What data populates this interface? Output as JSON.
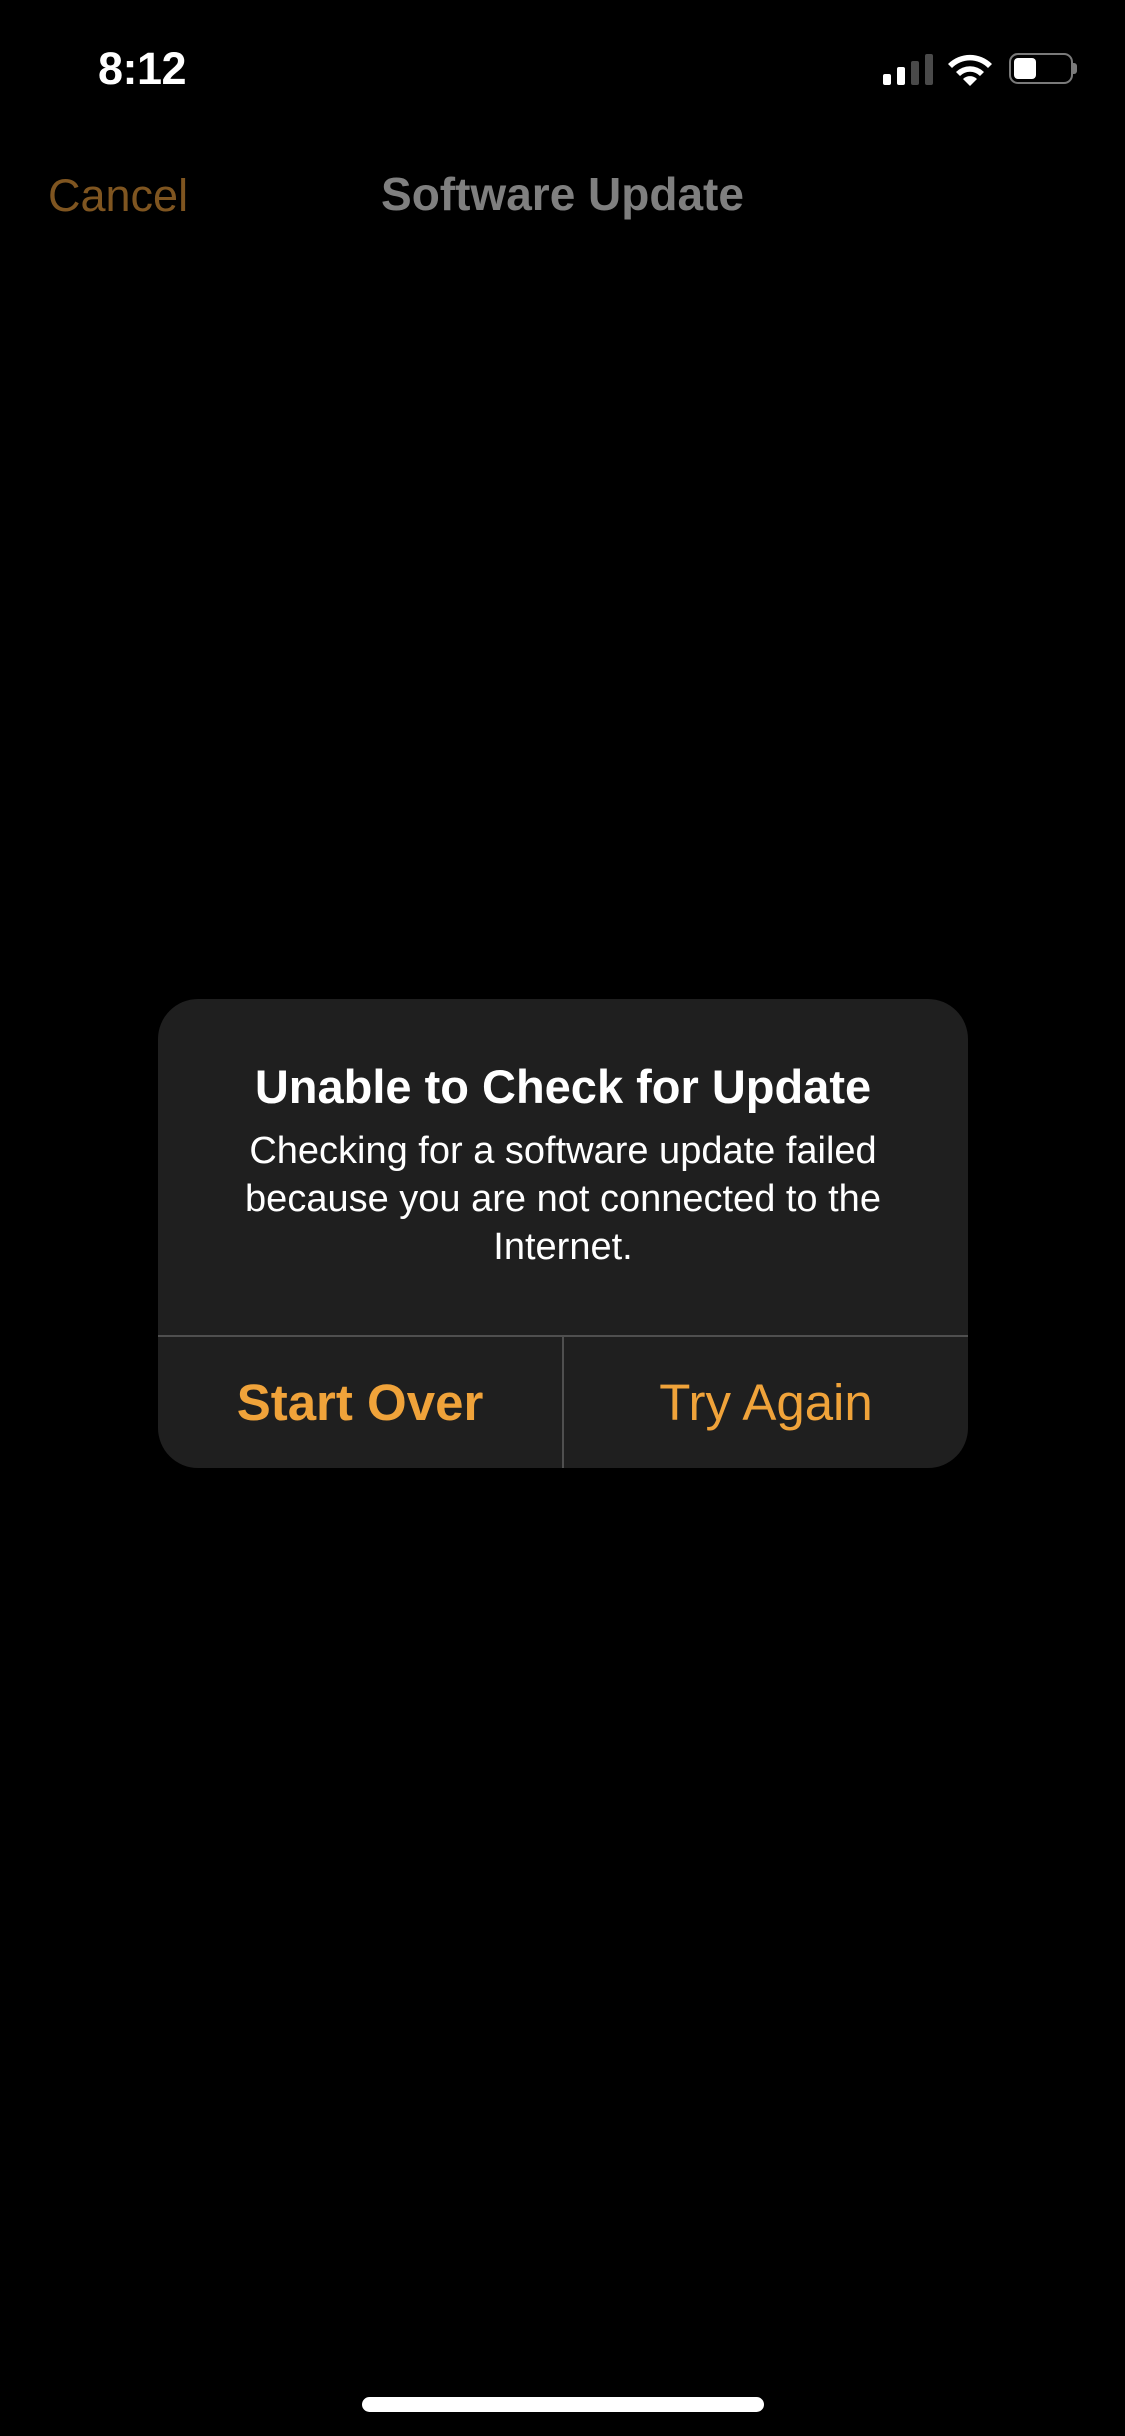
{
  "status_bar": {
    "time": "8:12",
    "signal_bars_total": 4,
    "signal_bars_active": 2,
    "wifi_icon": "wifi-icon",
    "battery_level": 0.4
  },
  "nav_bar": {
    "cancel_label": "Cancel",
    "title": "Software Update"
  },
  "alert": {
    "title": "Unable to Check for Update",
    "message": "Checking for a software update failed because you are not connected to the Internet.",
    "buttons": [
      {
        "label": "Start Over",
        "style": "bold"
      },
      {
        "label": "Try Again",
        "style": "regular"
      }
    ]
  },
  "colors": {
    "accent": "#f0a33a",
    "accent_dimmed": "#7f5520",
    "title_dimmed": "#7f7f7f",
    "alert_background": "#1f1f1f",
    "background": "#000000"
  }
}
